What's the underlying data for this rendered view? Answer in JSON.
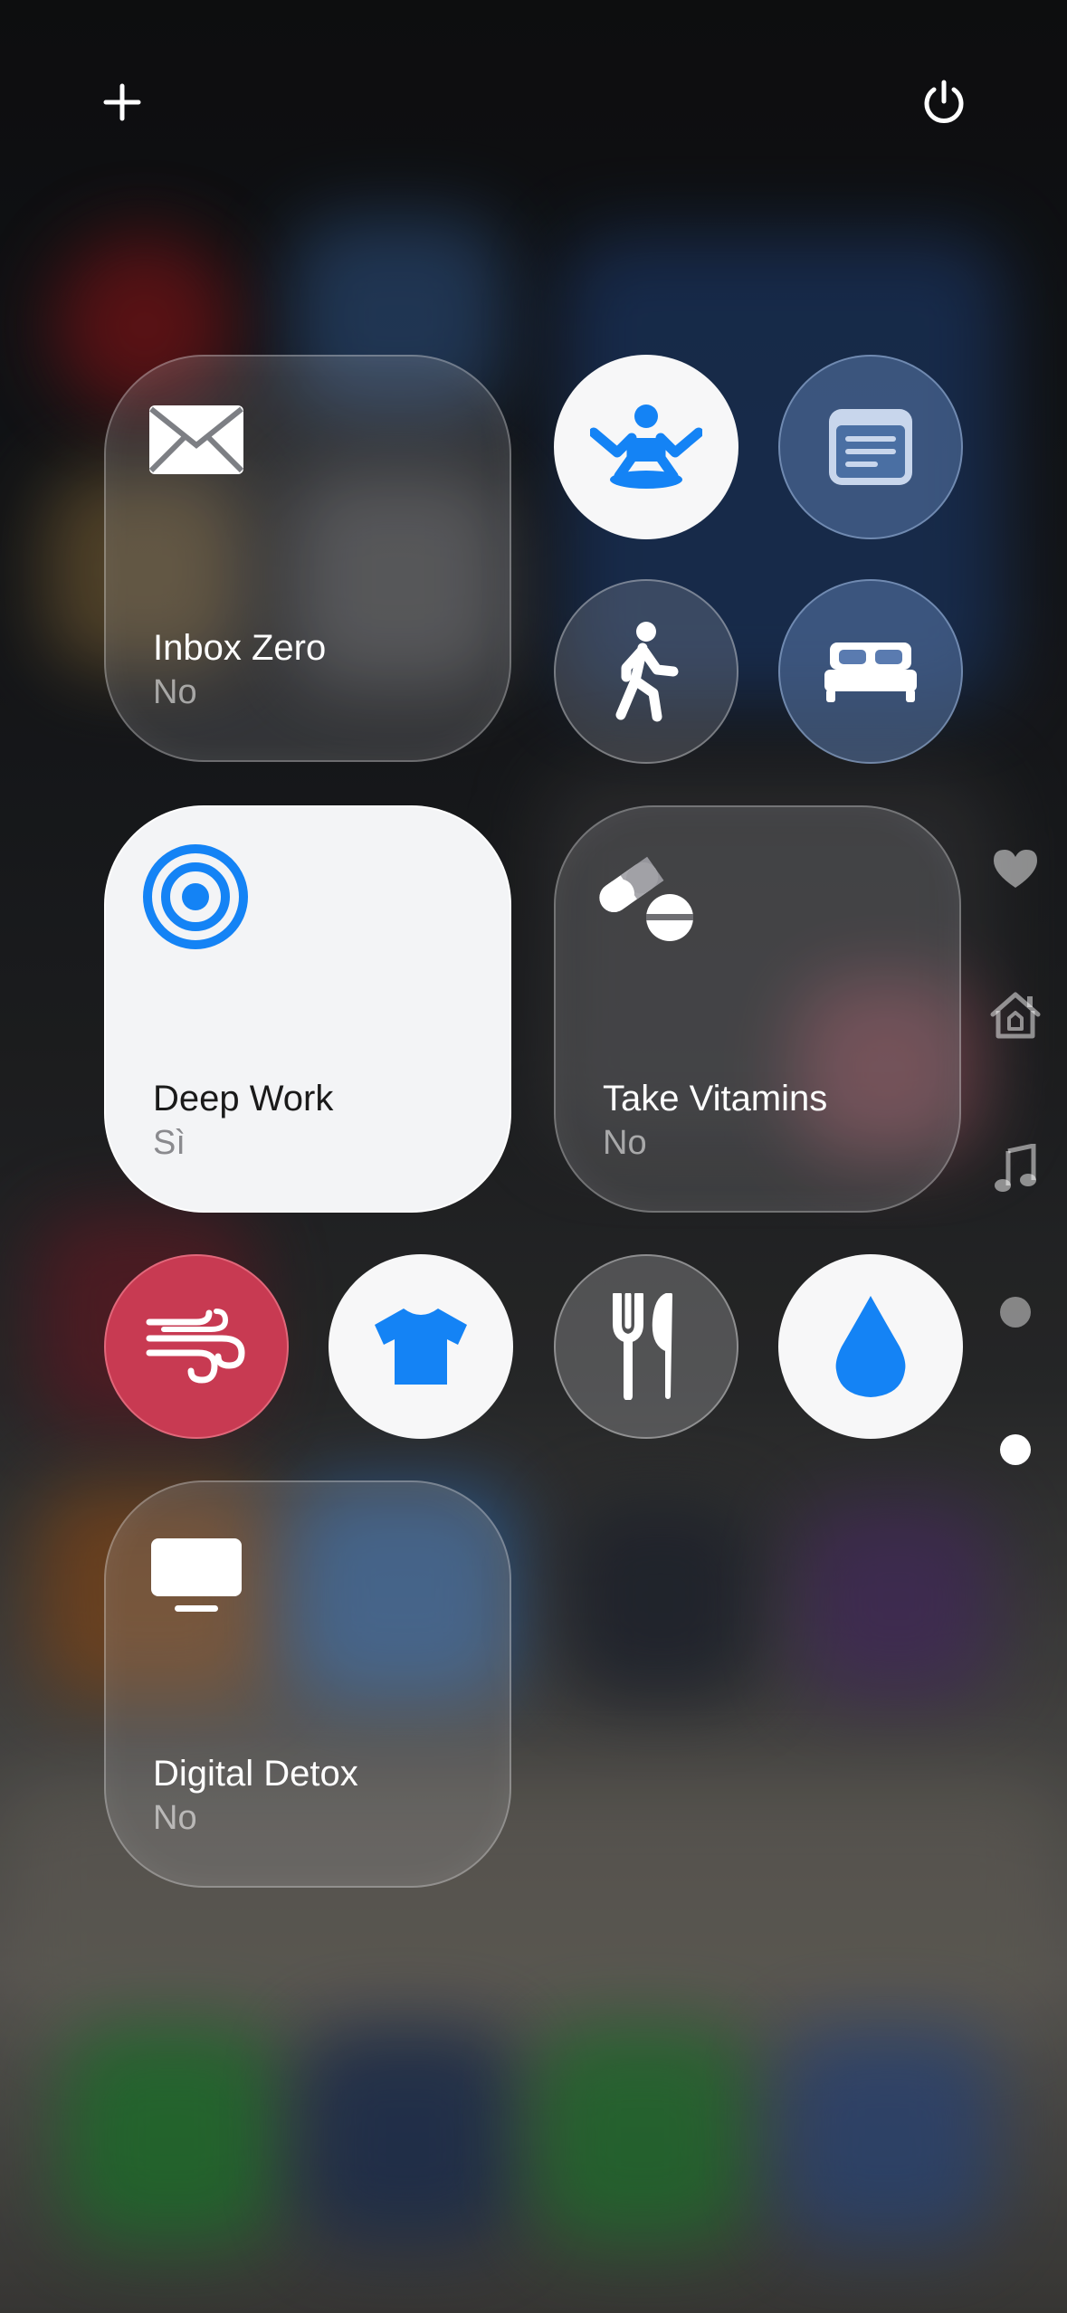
{
  "top_bar": {
    "add_icon": "plus-icon",
    "power_icon": "power-icon"
  },
  "tiles": [
    {
      "id": "inbox-zero",
      "title": "Inbox Zero",
      "status": "No",
      "icon": "envelope-icon",
      "active": false
    },
    {
      "id": "deep-work",
      "title": "Deep Work",
      "status": "Sì",
      "icon": "target-icon",
      "active": true
    },
    {
      "id": "take-vitamins",
      "title": "Take Vitamins",
      "status": "No",
      "icon": "pills-icon",
      "active": false
    },
    {
      "id": "digital-detox",
      "title": "Digital Detox",
      "status": "No",
      "icon": "tv-icon",
      "active": false
    }
  ],
  "circle_buttons": [
    {
      "id": "meditate",
      "icon": "meditation-figure-icon",
      "active": true
    },
    {
      "id": "reading",
      "icon": "reader-icon",
      "active": false
    },
    {
      "id": "walk",
      "icon": "walking-figure-icon",
      "active": false
    },
    {
      "id": "sleep",
      "icon": "bed-icon",
      "active": false
    },
    {
      "id": "breathe",
      "icon": "wind-icon",
      "active": true
    },
    {
      "id": "dress",
      "icon": "tshirt-icon",
      "active": true
    },
    {
      "id": "eat",
      "icon": "fork-knife-icon",
      "active": false
    },
    {
      "id": "hydrate",
      "icon": "water-drop-icon",
      "active": true
    }
  ],
  "page_rail": [
    {
      "icon": "heart-icon"
    },
    {
      "icon": "home-icon"
    },
    {
      "icon": "music-note-icon"
    },
    {
      "icon": "page-dot-icon"
    },
    {
      "icon": "page-dot-current-icon"
    }
  ],
  "colors": {
    "accent_blue": "#1483f5",
    "breathe_red": "#c83a52"
  }
}
